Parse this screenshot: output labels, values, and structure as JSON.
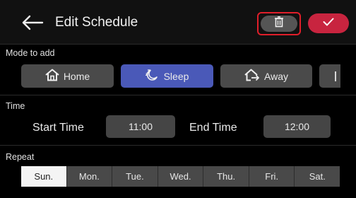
{
  "header": {
    "title": "Edit Schedule"
  },
  "mode_section": {
    "label": "Mode to add",
    "modes": [
      {
        "label": "Home",
        "icon": "home-icon",
        "active": false
      },
      {
        "label": "Sleep",
        "icon": "sleep-icon",
        "active": true
      },
      {
        "label": "Away",
        "icon": "away-icon",
        "active": false
      }
    ]
  },
  "time_section": {
    "label": "Time",
    "start_label": "Start Time",
    "start_value": "11:00",
    "end_label": "End Time",
    "end_value": "12:00"
  },
  "repeat_section": {
    "label": "Repeat",
    "days": [
      "Sun.",
      "Mon.",
      "Tue.",
      "Wed.",
      "Thu.",
      "Fri.",
      "Sat."
    ],
    "selected": "Sun."
  },
  "colors": {
    "active_mode": "#4a59b8",
    "confirm": "#c8243f",
    "delete_highlight": "#e01e2a"
  }
}
